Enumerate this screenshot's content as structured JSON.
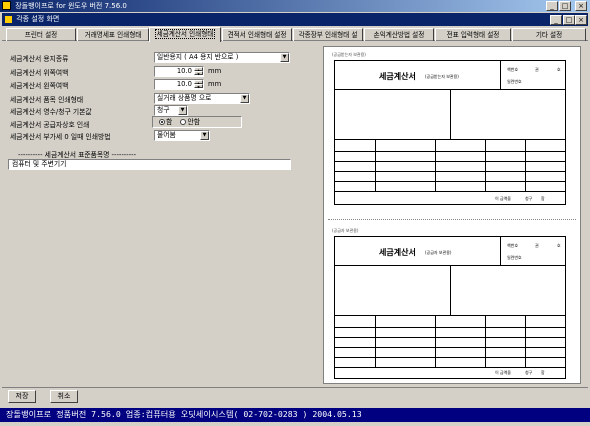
{
  "window": {
    "title": "장돌뱅이프로 for 윈도우 버전 7.56.0",
    "min": "_",
    "max": "□",
    "close": "×"
  },
  "child": {
    "title": "각종 설정 화면",
    "min": "_",
    "max": "□",
    "close": "×"
  },
  "tabs": [
    "프린터 설정",
    "거래명세표 인쇄형태",
    "세금계산서 인쇄형태",
    "견적서 인쇄형태 설정",
    "각종장부 인쇄형태 설",
    "손익계산방법 설정",
    "전표 입력형태 설정",
    "기타 설정"
  ],
  "form": {
    "paper_type_label": "세금계산서 용지종류",
    "paper_type_value": "일반용지 ( A4 용지 반으로 )",
    "top_margin_label": "세금계산서 위쪽여백",
    "top_margin_value": "10.0",
    "left_margin_label": "세금계산서 왼쪽여백",
    "left_margin_value": "10.0",
    "unit": "mm",
    "item_print_label": "세금계산서 품목 인쇄형태",
    "item_print_value": "실거래 상품명 으로",
    "receipt_label": "세금계산서  영수/청구 기본값",
    "receipt_value": "청구",
    "supplier_seal_label": "세금계산서 공급자상호 인쇄",
    "radio_yes": "함",
    "radio_no": "안함",
    "vat_zero_label": "세금계산서 부가세 0 일때 인쇄방법",
    "vat_zero_value": "물어봄",
    "standard_item_label": "----------    세금계산서 표준품목명    ----------",
    "standard_item_value": "컴퓨터 및 주변기기"
  },
  "buttons": {
    "save": "저장",
    "cancel": "취소"
  },
  "status": "장돌뱅이프로 정품버전 7.56.0   업종:컴퓨터용   오딧세이시스템( 02-702-0283 )   2004.05.13",
  "preview": {
    "title": "세금계산서",
    "sub_top": "(공급받는자 보관용)",
    "sub_bottom": "(공급자 보관용)",
    "book_no_label": "책번호",
    "vol": "권",
    "no": "호",
    "serial_label": "일련번호",
    "receipt_word": "청구",
    "receipt_suffix": "함",
    "amount_label": "이 금액을"
  }
}
